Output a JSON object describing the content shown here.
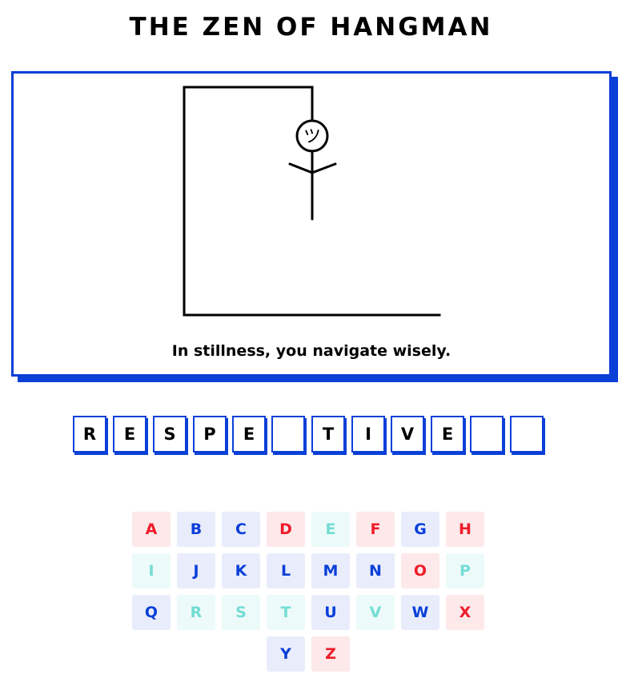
{
  "title": "THE ZEN OF HANGMAN",
  "message": "In stillness, you navigate wisely.",
  "colors": {
    "accent": "#0a3fd8",
    "unused_bg": "#e9edfb",
    "unused_fg": "#0a3fd8",
    "wrong_bg": "#fde8ea",
    "wrong_fg": "#ef1b2a",
    "right_bg": "#ecfbf9",
    "right_fg": "#73ddd4"
  },
  "hangman": {
    "face_glyph": "ツ",
    "parts_shown": [
      "head",
      "arms",
      "body"
    ]
  },
  "word_slots": [
    "R",
    "E",
    "S",
    "P",
    "E",
    "",
    "T",
    "I",
    "V",
    "E",
    "",
    ""
  ],
  "keyboard": [
    {
      "letter": "A",
      "state": "wrong"
    },
    {
      "letter": "B",
      "state": "unused"
    },
    {
      "letter": "C",
      "state": "unused"
    },
    {
      "letter": "D",
      "state": "wrong"
    },
    {
      "letter": "E",
      "state": "right"
    },
    {
      "letter": "F",
      "state": "wrong"
    },
    {
      "letter": "G",
      "state": "unused"
    },
    {
      "letter": "H",
      "state": "wrong"
    },
    {
      "letter": "I",
      "state": "right"
    },
    {
      "letter": "J",
      "state": "unused"
    },
    {
      "letter": "K",
      "state": "unused"
    },
    {
      "letter": "L",
      "state": "unused"
    },
    {
      "letter": "M",
      "state": "unused"
    },
    {
      "letter": "N",
      "state": "unused"
    },
    {
      "letter": "O",
      "state": "wrong"
    },
    {
      "letter": "P",
      "state": "right"
    },
    {
      "letter": "Q",
      "state": "unused"
    },
    {
      "letter": "R",
      "state": "right"
    },
    {
      "letter": "S",
      "state": "right"
    },
    {
      "letter": "T",
      "state": "right"
    },
    {
      "letter": "U",
      "state": "unused"
    },
    {
      "letter": "V",
      "state": "right"
    },
    {
      "letter": "W",
      "state": "unused"
    },
    {
      "letter": "X",
      "state": "wrong"
    },
    {
      "letter": "Y",
      "state": "unused"
    },
    {
      "letter": "Z",
      "state": "wrong"
    }
  ]
}
